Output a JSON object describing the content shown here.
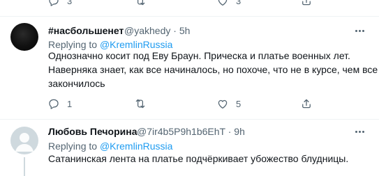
{
  "top_actions": {
    "reply_count": "3",
    "retweet_count": "",
    "like_count": "3"
  },
  "tweets": [
    {
      "display_name": "#насбольшенет",
      "handle": "@yakhedy",
      "separator": "·",
      "time": "5h",
      "replying_prefix": "Replying to",
      "replying_to": "@KremlinRussia",
      "text_lines": [
        "Однозначно косит под Еву Браун. Прическа и платье военных лет.",
        "Наверняка знает, как все начиналось, но похоче, что не в курсе, чем все",
        "закончилось"
      ],
      "reply_count": "1",
      "retweet_count": "",
      "like_count": "5"
    },
    {
      "display_name": "Любовь Печорина",
      "handle": "@7ir4b5P9h1b6EhT",
      "separator": "·",
      "time": "9h",
      "replying_prefix": "Replying to",
      "replying_to": "@KremlinRussia",
      "text_lines": [
        "Сатанинская лента на платье подчёркивает убожество блудницы."
      ]
    }
  ],
  "icons": {
    "reply": "reply-icon",
    "retweet": "retweet-icon",
    "like": "heart-icon",
    "share": "share-icon",
    "more": "more-icon"
  },
  "colors": {
    "text": "#0f1419",
    "secondary": "#536471",
    "link": "#1d9bf0",
    "divider": "#eff3f4"
  }
}
